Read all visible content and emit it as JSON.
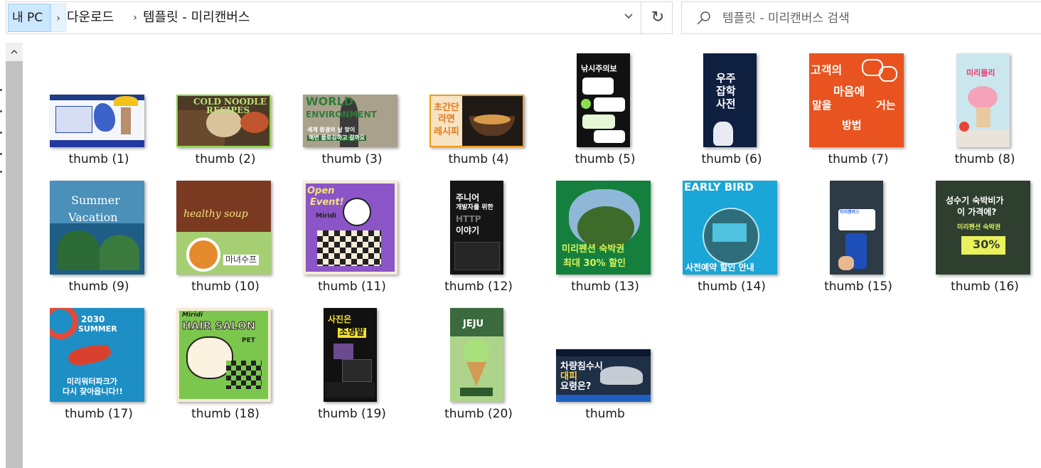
{
  "address_bar": {
    "crumbs": [
      "내 PC",
      "다운로드",
      "템플릿 - 미리캔버스"
    ],
    "separator": "›",
    "dropdown_glyph": "⌄",
    "refresh_glyph": "↻"
  },
  "search": {
    "placeholder": "템플릿 - 미리캔버스 검색"
  },
  "scrollbar": {
    "up_glyph": "˄"
  },
  "thumb_texts": {
    "t1": "",
    "t2a": "COLD NOODLE",
    "t2b": "RECIPES",
    "t3a": "WORLD",
    "t3b": "ENVIRONMENT",
    "t3c": "세계 환경의 날 맞이",
    "t3d": "해변 플로깅하고 갈까요",
    "t4a": "초간단",
    "t4b": "라면",
    "t4c": "레시피",
    "t5": "낚시주의보",
    "t6a": "우주",
    "t6b": "잡학",
    "t6c": "사전",
    "t7a": "고객의",
    "t7b": "마음에",
    "t7c": "말을",
    "t7d": "거는",
    "t7e": "방법",
    "t8": "미리몰리",
    "t9a": "Summer",
    "t9b": "Vacation",
    "t10a": "healthy soup",
    "t10b": "마녀수프",
    "t11a": "Open",
    "t11b": "Event!",
    "t11c": "Miridi",
    "t12a": "주니어",
    "t12b": "개발자를 위한",
    "t12c": "HTTP",
    "t12d": "이야기",
    "t13a": "미리펜션 숙박권",
    "t13b": "최대 30% 할인",
    "t14a": "EARLY BIRD",
    "t14b": "사전예약 할인 안내",
    "t15": "미리캔버스",
    "t16a": "성수기 숙박비가",
    "t16b": "이 가격에?",
    "t16c": "미리펜션 숙박권",
    "t16d": "30%",
    "t17a": "2030",
    "t17b": "SUMMER",
    "t17c": "미리워터파크가",
    "t17d": "다시 찾아옵니다!!",
    "t18a": "Miridi",
    "t18b": "HAIR SALON",
    "t18c": "PET",
    "t19a": "사진은",
    "t19b": "조명발",
    "t20": "JEJU",
    "t21a": "차량침수시",
    "t21b": "대피",
    "t21c": "요령은?"
  },
  "files": [
    {
      "name": "thumb (1)"
    },
    {
      "name": "thumb (2)"
    },
    {
      "name": "thumb (3)"
    },
    {
      "name": "thumb (4)"
    },
    {
      "name": "thumb (5)"
    },
    {
      "name": "thumb (6)"
    },
    {
      "name": "thumb (7)"
    },
    {
      "name": "thumb (8)"
    },
    {
      "name": "thumb (9)"
    },
    {
      "name": "thumb (10)"
    },
    {
      "name": "thumb (11)"
    },
    {
      "name": "thumb (12)"
    },
    {
      "name": "thumb (13)"
    },
    {
      "name": "thumb (14)"
    },
    {
      "name": "thumb (15)"
    },
    {
      "name": "thumb (16)"
    },
    {
      "name": "thumb (17)"
    },
    {
      "name": "thumb (18)"
    },
    {
      "name": "thumb (19)"
    },
    {
      "name": "thumb (20)"
    },
    {
      "name": "thumb"
    }
  ],
  "colors": {
    "selected_crumb": "#cce8ff",
    "scrollbar_track": "#f0f0f0",
    "scrollbar_thumb": "#c2c2c2"
  }
}
